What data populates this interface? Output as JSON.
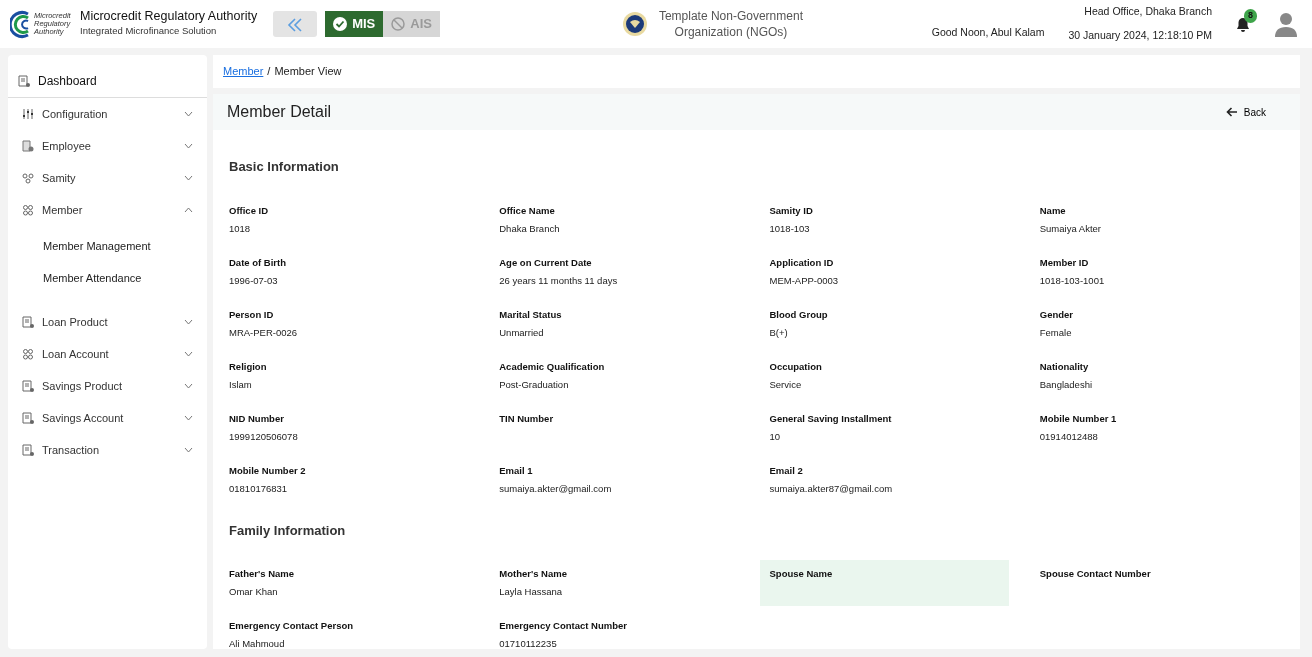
{
  "header": {
    "org_name": "Microcredit Regulatory Authority",
    "org_subtitle": "Integrated Microfinance Solution",
    "logo_text": "Microcredit Regulatory Authority",
    "modules": [
      {
        "label": "MIS",
        "selected": true
      },
      {
        "label": "AIS",
        "selected": false
      }
    ],
    "ngo_name": "Template Non-Government Organization (NGOs)",
    "greeting": "Good Noon, Abul Kalam",
    "office": "Head Office, Dhaka Branch",
    "datetime": "30 January 2024, 12:18:10 PM",
    "notification_count": "8"
  },
  "sidebar": {
    "items": [
      {
        "label": "Dashboard"
      },
      {
        "label": "Configuration",
        "expanded": false
      },
      {
        "label": "Employee",
        "expanded": false
      },
      {
        "label": "Samity",
        "expanded": false
      },
      {
        "label": "Member",
        "expanded": true,
        "children": [
          {
            "label": "Member Management"
          },
          {
            "label": "Member Attendance"
          }
        ]
      },
      {
        "label": "Loan Product",
        "expanded": false
      },
      {
        "label": "Loan Account",
        "expanded": false
      },
      {
        "label": "Savings Product",
        "expanded": false
      },
      {
        "label": "Savings Account",
        "expanded": false
      },
      {
        "label": "Transaction",
        "expanded": false
      }
    ]
  },
  "breadcrumb": [
    {
      "label": "Member",
      "link": true
    },
    {
      "label": "Member View",
      "link": false
    }
  ],
  "breadcrumb_separator": "/",
  "page_title": "Member Detail",
  "back_label": "Back",
  "sections": [
    {
      "title": "Basic Information",
      "fields": [
        {
          "label": "Office ID",
          "value": "1018",
          "highlighted": false
        },
        {
          "label": "Office Name",
          "value": "Dhaka Branch",
          "highlighted": false
        },
        {
          "label": "Samity ID",
          "value": "1018-103",
          "highlighted": false
        },
        {
          "label": "Name",
          "value": "Sumaiya Akter",
          "highlighted": false
        },
        {
          "label": "Date of Birth",
          "value": "1996-07-03",
          "highlighted": false
        },
        {
          "label": "Age on Current Date",
          "value": "26 years 11 months 11 days",
          "highlighted": false
        },
        {
          "label": "Application ID",
          "value": "MEM-APP-0003",
          "highlighted": false
        },
        {
          "label": "Member ID",
          "value": "1018-103-1001",
          "highlighted": false
        },
        {
          "label": "Person ID",
          "value": "MRA-PER-0026",
          "highlighted": false
        },
        {
          "label": "Marital Status",
          "value": "Unmarried",
          "highlighted": false
        },
        {
          "label": "Blood Group",
          "value": "B(+)",
          "highlighted": false
        },
        {
          "label": "Gender",
          "value": "Female",
          "highlighted": false
        },
        {
          "label": "Religion",
          "value": "Islam",
          "highlighted": false
        },
        {
          "label": "Academic Qualification",
          "value": "Post-Graduation",
          "highlighted": false
        },
        {
          "label": "Occupation",
          "value": "Service",
          "highlighted": false
        },
        {
          "label": "Nationality",
          "value": "Bangladeshi",
          "highlighted": false
        },
        {
          "label": "NID Number",
          "value": "1999120506078",
          "highlighted": false
        },
        {
          "label": "TIN Number",
          "highlighted": false
        },
        {
          "label": "General Saving Installment",
          "value": "10",
          "highlighted": false
        },
        {
          "label": "Mobile Number 1",
          "value": "01914012488",
          "highlighted": false
        },
        {
          "label": "Mobile Number 2",
          "value": "01810176831",
          "highlighted": false
        },
        {
          "label": "Email 1",
          "value": "sumaiya.akter@gmail.com",
          "highlighted": false
        },
        {
          "label": "Email 2",
          "value": "sumaiya.akter87@gmail.com",
          "highlighted": false
        }
      ]
    },
    {
      "title": "Family Information",
      "fields": [
        {
          "label": "Father's Name",
          "value": "Omar Khan",
          "highlighted": false
        },
        {
          "label": "Mother's Name",
          "value": "Layla Hassana",
          "highlighted": false
        },
        {
          "label": "Spouse Name",
          "highlighted": true
        },
        {
          "label": "Spouse Contact Number",
          "highlighted": false
        },
        {
          "label": "Emergency Contact Person",
          "value": "Ali Mahmoud",
          "highlighted": false
        },
        {
          "label": "Emergency Contact Number",
          "value": "01710112235",
          "highlighted": false
        }
      ]
    }
  ]
}
